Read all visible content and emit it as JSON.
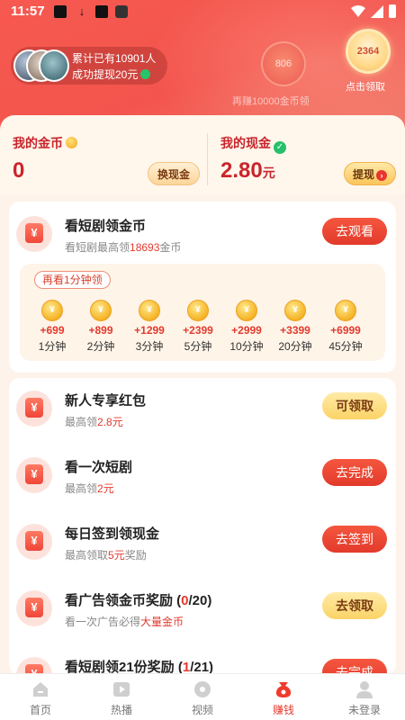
{
  "status_bar": {
    "time": "11:57"
  },
  "hero": {
    "withdraw_line1": "累计已有10901人",
    "withdraw_line2": "成功提现20元",
    "bubble_small": "806",
    "bubble_big": "2364",
    "note": "再赚10000金币领",
    "claim_label": "点击领取"
  },
  "wallet": {
    "coins_label": "我的金币",
    "coins_value": "0",
    "exchange_label": "换现金",
    "cash_label": "我的现金",
    "cash_value": "2.80",
    "cash_unit": "元",
    "withdraw_label": "提现"
  },
  "tasks": {
    "watch": {
      "title": "看短剧领金币",
      "sub_prefix": "看短剧最高领",
      "sub_highlight": "18693",
      "sub_suffix": "金币",
      "button": "去观看"
    },
    "ladder_tag": "再看1分钟领",
    "ladder": [
      {
        "amount": "+699",
        "duration": "1分钟"
      },
      {
        "amount": "+899",
        "duration": "2分钟"
      },
      {
        "amount": "+1299",
        "duration": "3分钟"
      },
      {
        "amount": "+2399",
        "duration": "5分钟"
      },
      {
        "amount": "+2999",
        "duration": "10分钟"
      },
      {
        "amount": "+3399",
        "duration": "20分钟"
      },
      {
        "amount": "+6999",
        "duration": "45分钟"
      }
    ],
    "newbie": {
      "title": "新人专享红包",
      "sub_prefix": "最高领",
      "sub_highlight": "2.8元",
      "button": "可领取"
    },
    "watch_once": {
      "title": "看一次短剧",
      "sub_prefix": "最高领",
      "sub_highlight": "2元",
      "button": "去完成"
    },
    "checkin": {
      "title": "每日签到领现金",
      "sub_prefix": "最高领取",
      "sub_highlight": "5元",
      "sub_suffix": "奖励",
      "button": "去签到"
    },
    "ads": {
      "title_prefix": "看广告领金币奖励 (",
      "title_highlight": "0",
      "title_suffix": "/20)",
      "sub_prefix": "看一次广告必得",
      "sub_highlight": "大量金币",
      "button": "去领取"
    },
    "drama21": {
      "title_prefix": "看短剧领21份奖励 (",
      "title_highlight": "1",
      "title_suffix": "/21)",
      "button": "去完成"
    }
  },
  "yuan_glyph": "¥",
  "tabbar": [
    {
      "label": "首页"
    },
    {
      "label": "热播"
    },
    {
      "label": "视频"
    },
    {
      "label": "赚钱"
    },
    {
      "label": "未登录"
    }
  ]
}
